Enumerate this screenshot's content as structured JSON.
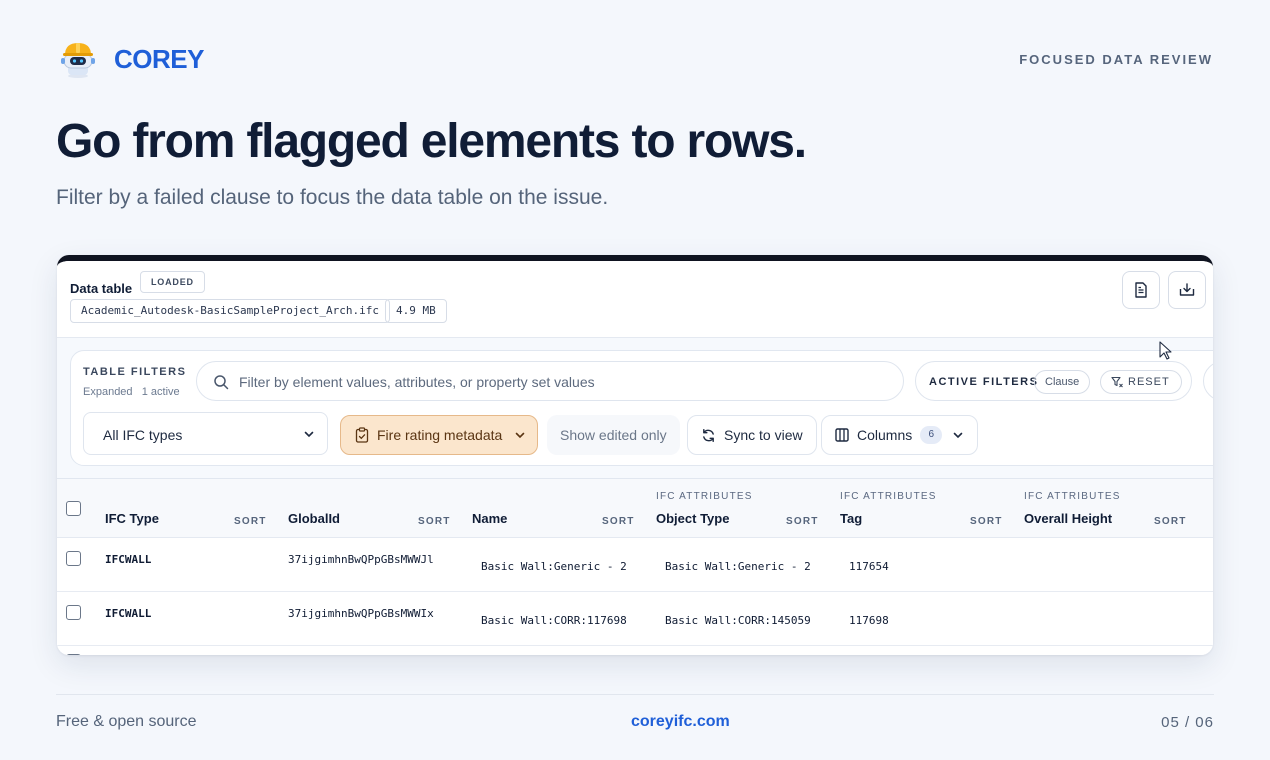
{
  "header": {
    "brand": "COREY",
    "eyebrow": "FOCUSED DATA REVIEW",
    "headline": "Go from flagged elements to rows.",
    "subhead": "Filter by a failed clause to focus the data table on the issue."
  },
  "panel": {
    "title": "Data table",
    "status_badge": "LOADED",
    "file_name": "Academic_Autodesk-BasicSampleProject_Arch.ifc",
    "file_size": "4.9 MB",
    "icons": {
      "report": "file-text-icon",
      "download": "download-icon"
    }
  },
  "filters": {
    "title": "TABLE FILTERS",
    "state": "Expanded",
    "active_count": "1 active",
    "search_placeholder": "Filter by element values, attributes, or property set values",
    "active_label": "ACTIVE FILTERS",
    "active_chip": "Clause",
    "reset_label": "RESET",
    "type_select": "All IFC types",
    "preset": "Fire rating metadata",
    "show_edited": "Show edited only",
    "sync": "Sync to view",
    "columns_label": "Columns",
    "columns_count": "6"
  },
  "table": {
    "sort_label": "SORT",
    "columns": [
      {
        "group": "",
        "name": "IFC Type"
      },
      {
        "group": "",
        "name": "GlobalId"
      },
      {
        "group": "",
        "name": "Name"
      },
      {
        "group": "IFC ATTRIBUTES",
        "name": "Object Type"
      },
      {
        "group": "IFC ATTRIBUTES",
        "name": "Tag"
      },
      {
        "group": "IFC ATTRIBUTES",
        "name": "Overall Height"
      }
    ],
    "rows": [
      {
        "ifc_type": "IFCWALL",
        "global_id": "37ijgimhnBwQPpGBsMWWJl",
        "name": "Basic Wall:Generic - 2",
        "object_type": "Basic Wall:Generic - 2",
        "tag": "117654",
        "overall_height": ""
      },
      {
        "ifc_type": "IFCWALL",
        "global_id": "37ijgimhnBwQPpGBsMWWIx",
        "name": "Basic Wall:CORR:117698",
        "object_type": "Basic Wall:CORR:145059",
        "tag": "117698",
        "overall_height": ""
      }
    ]
  },
  "footer": {
    "left": "Free & open source",
    "center": "coreyifc.com",
    "page": "05 / 06"
  }
}
